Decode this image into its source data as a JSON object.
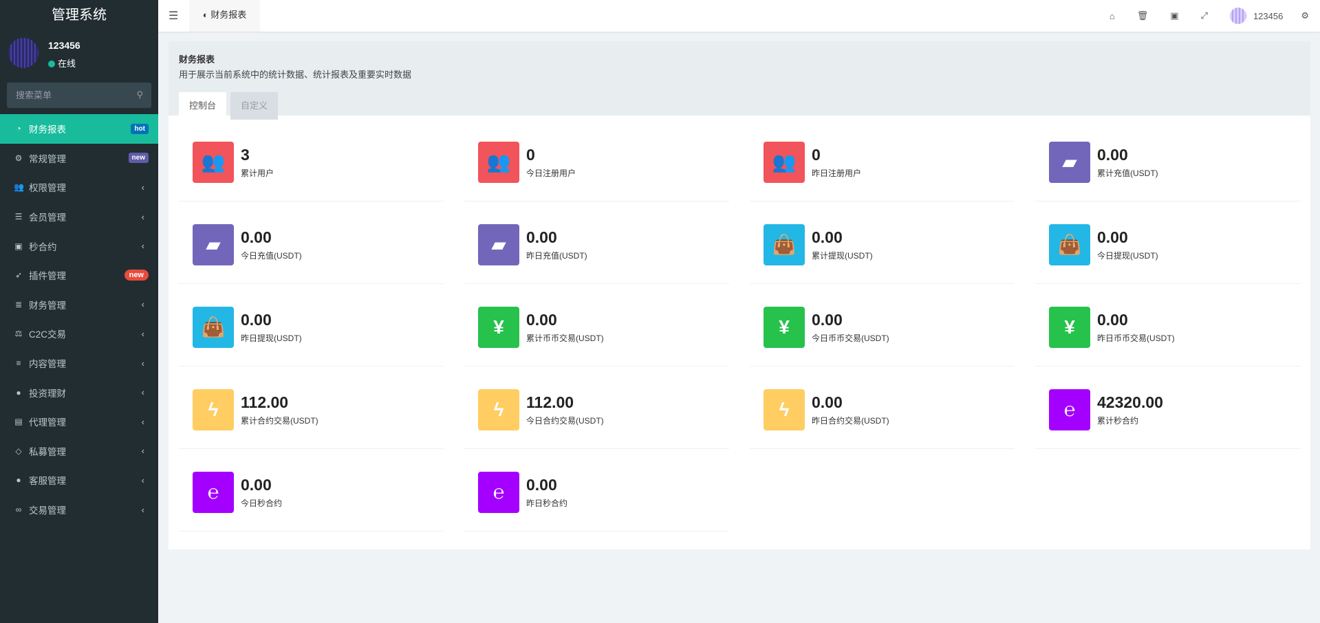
{
  "app": {
    "title": "管理系统"
  },
  "user": {
    "name": "123456",
    "status": "在线"
  },
  "search": {
    "placeholder": "搜索菜单"
  },
  "menu": [
    {
      "label": "财务报表",
      "icon": "dashboard-icon",
      "badge": "hot",
      "active": true
    },
    {
      "label": "常规管理",
      "icon": "cogs-icon",
      "badge": "new"
    },
    {
      "label": "权限管理",
      "icon": "group-icon"
    },
    {
      "label": "会员管理",
      "icon": "list-icon"
    },
    {
      "label": "秒合约",
      "icon": "calendar-icon"
    },
    {
      "label": "插件管理",
      "icon": "rocket-icon",
      "badge": "new"
    },
    {
      "label": "财务管理",
      "icon": "database-icon"
    },
    {
      "label": "C2C交易",
      "icon": "balance-scale-icon"
    },
    {
      "label": "内容管理",
      "icon": "align-left-icon"
    },
    {
      "label": "投资理财",
      "icon": "compass-icon"
    },
    {
      "label": "代理管理",
      "icon": "briefcase-icon"
    },
    {
      "label": "私募管理",
      "icon": "diamond-icon"
    },
    {
      "label": "客服管理",
      "icon": "comment-icon"
    },
    {
      "label": "交易管理",
      "icon": "handshake-icon"
    }
  ],
  "topbar": {
    "tab": "财务报表",
    "username": "123456"
  },
  "page": {
    "title": "财务报表",
    "desc": "用于展示当前系统中的统计数据、统计报表及重要实时数据",
    "tabs": [
      "控制台",
      "自定义"
    ]
  },
  "colors": {
    "red": "#f1545a",
    "purple": "#7266ba",
    "cyan": "#23b7e5",
    "green": "#27c24c",
    "yellow": "#ffcd62",
    "violet": "#a400ff"
  },
  "stats": [
    {
      "value": "3",
      "label": "累计用户",
      "color": "red",
      "icon": "users-icon"
    },
    {
      "value": "0",
      "label": "今日注册用户",
      "color": "red",
      "icon": "users-icon"
    },
    {
      "value": "0",
      "label": "昨日注册用户",
      "color": "red",
      "icon": "users-icon"
    },
    {
      "value": "0.00",
      "label": "累计充值(USDT)",
      "color": "purple",
      "icon": "book-icon"
    },
    {
      "value": "0.00",
      "label": "今日充值(USDT)",
      "color": "purple",
      "icon": "book-icon"
    },
    {
      "value": "0.00",
      "label": "昨日充值(USDT)",
      "color": "purple",
      "icon": "book-icon"
    },
    {
      "value": "0.00",
      "label": "累计提现(USDT)",
      "color": "cyan",
      "icon": "shopping-bag-icon"
    },
    {
      "value": "0.00",
      "label": "今日提现(USDT)",
      "color": "cyan",
      "icon": "shopping-bag-icon"
    },
    {
      "value": "0.00",
      "label": "昨日提现(USDT)",
      "color": "cyan",
      "icon": "shopping-bag-icon"
    },
    {
      "value": "0.00",
      "label": "累计币币交易(USDT)",
      "color": "green",
      "icon": "yen-icon"
    },
    {
      "value": "0.00",
      "label": "今日币币交易(USDT)",
      "color": "green",
      "icon": "yen-icon"
    },
    {
      "value": "0.00",
      "label": "昨日币币交易(USDT)",
      "color": "green",
      "icon": "yen-icon"
    },
    {
      "value": "112.00",
      "label": "累计合约交易(USDT)",
      "color": "yellow",
      "icon": "bolt-icon"
    },
    {
      "value": "112.00",
      "label": "今日合约交易(USDT)",
      "color": "yellow",
      "icon": "bolt-icon"
    },
    {
      "value": "0.00",
      "label": "昨日合约交易(USDT)",
      "color": "yellow",
      "icon": "bolt-icon"
    },
    {
      "value": "42320.00",
      "label": "累计秒合约",
      "color": "violet",
      "icon": "ethereum-icon"
    },
    {
      "value": "0.00",
      "label": "今日秒合约",
      "color": "violet",
      "icon": "ethereum-icon"
    },
    {
      "value": "0.00",
      "label": "昨日秒合约",
      "color": "violet",
      "icon": "ethereum-icon"
    }
  ]
}
